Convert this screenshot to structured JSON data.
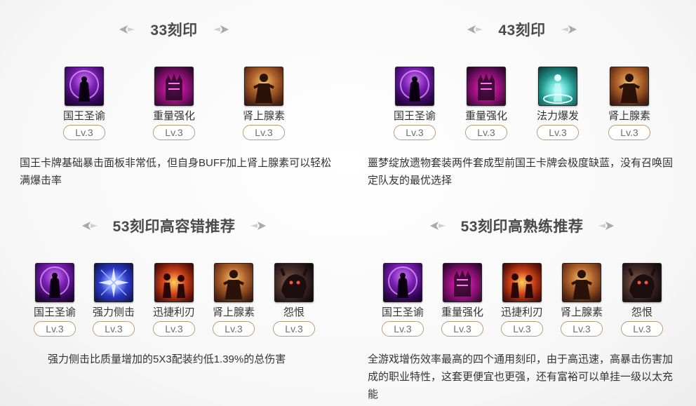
{
  "sections": [
    {
      "title": "33刻印",
      "runes": [
        {
          "name": "国王圣谕",
          "level": "Lv.3",
          "icon": "king-edict-icon"
        },
        {
          "name": "重量强化",
          "level": "Lv.3",
          "icon": "weight-enhance-icon"
        },
        {
          "name": "肾上腺素",
          "level": "Lv.3",
          "icon": "adrenaline-icon"
        }
      ],
      "desc": "国王卡牌基础暴击面板非常低，但自身BUFF加上肾上腺素可以轻松满爆击率"
    },
    {
      "title": "43刻印",
      "runes": [
        {
          "name": "国王圣谕",
          "level": "Lv.3",
          "icon": "king-edict-icon"
        },
        {
          "name": "重量强化",
          "level": "Lv.3",
          "icon": "weight-enhance-icon"
        },
        {
          "name": "法力爆发",
          "level": "Lv.3",
          "icon": "mana-burst-icon"
        },
        {
          "name": "肾上腺素",
          "level": "Lv.3",
          "icon": "adrenaline-icon"
        }
      ],
      "desc": "噩梦绽放遗物套装两件套成型前国王卡牌会极度缺蓝，没有召唤固定队友的最优选择"
    },
    {
      "title": "53刻印高容错推荐",
      "runes": [
        {
          "name": "国王圣谕",
          "level": "Lv.3",
          "icon": "king-edict-icon"
        },
        {
          "name": "强力侧击",
          "level": "Lv.3",
          "icon": "strong-flank-icon"
        },
        {
          "name": "迅捷利刃",
          "level": "Lv.3",
          "icon": "swift-blade-icon"
        },
        {
          "name": "肾上腺素",
          "level": "Lv.3",
          "icon": "adrenaline-icon"
        },
        {
          "name": "怨恨",
          "level": "Lv.3",
          "icon": "grudge-icon"
        }
      ],
      "desc": "强力侧击比质量增加的5X3配装约低1.39%的总伤害"
    },
    {
      "title": "53刻印高熟练推荐",
      "runes": [
        {
          "name": "国王圣谕",
          "level": "Lv.3",
          "icon": "king-edict-icon"
        },
        {
          "name": "重量强化",
          "level": "Lv.3",
          "icon": "weight-enhance-icon"
        },
        {
          "name": "迅捷利刃",
          "level": "Lv.3",
          "icon": "swift-blade-icon"
        },
        {
          "name": "肾上腺素",
          "level": "Lv.3",
          "icon": "adrenaline-icon"
        },
        {
          "name": "怨恨",
          "level": "Lv.3",
          "icon": "grudge-icon"
        }
      ],
      "desc": "全游戏增伤效率最高的四个通用刻印，由于高迅速，高暴击伤害加成的职业特性，这套更便宜也更强，还有富裕可以单挂一级以太充能"
    }
  ]
}
